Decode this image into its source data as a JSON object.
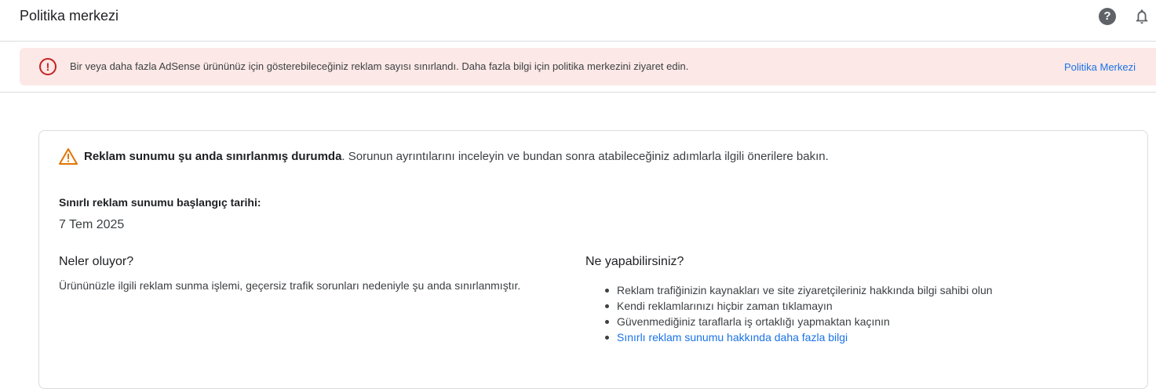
{
  "header": {
    "title": "Politika merkezi",
    "help_icon": "help-icon",
    "notifications_icon": "bell-icon"
  },
  "alert": {
    "icon": "error-icon",
    "message": "Bir veya daha fazla AdSense ürününüz için gösterebileceğiniz reklam sayısı sınırlandı. Daha fazla bilgi için politika merkezini ziyaret edin.",
    "link_label": "Politika Merkezi",
    "color": "#c5221f",
    "background": "#fce8e6"
  },
  "card": {
    "warning_icon": "warning-icon",
    "warning_bold": "Reklam sunumu şu anda sınırlanmış durumda",
    "warning_rest": ". Sorunun ayrıntılarını inceleyin ve bundan sonra atabileceğiniz adımlarla ilgili önerilere bakın.",
    "start_label": "Sınırlı reklam sunumu başlangıç tarihi:",
    "start_date": "7 Tem 2025",
    "left_title": "Neler oluyor?",
    "left_body": "Ürününüzle ilgili reklam sunma işlemi, geçersiz trafik sorunları nedeniyle şu anda sınırlanmıştır.",
    "right_title": "Ne yapabilirsiniz?",
    "tips": [
      "Reklam trafiğinizin kaynakları ve site ziyaretçileriniz hakkında bilgi sahibi olun",
      "Kendi reklamlarınızı hiçbir zaman tıklamayın",
      "Güvenmediğiniz taraflarla iş ortaklığı yapmaktan kaçının"
    ],
    "learn_more_link": "Sınırlı reklam sunumu hakkında daha fazla bilgi"
  }
}
